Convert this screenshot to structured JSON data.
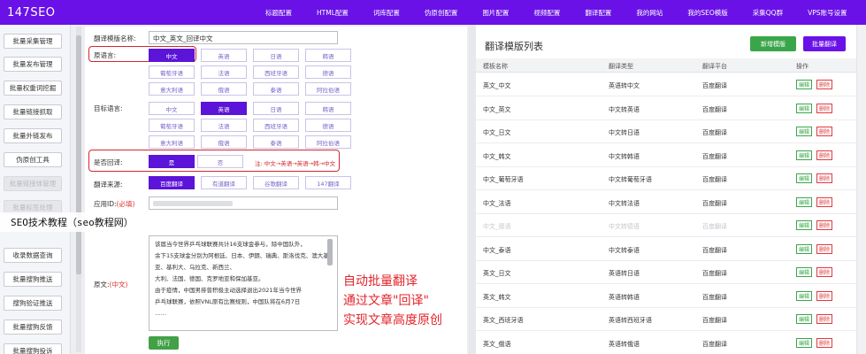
{
  "app": {
    "logo": "147SEO"
  },
  "top_nav": [
    "标题配置",
    "HTML配置",
    "词库配置",
    "伪原创配置",
    "图片配置",
    "视频配置",
    "翻译配置",
    "我的网站",
    "我的SEO模版",
    "采集QQ群",
    "VPS账号设置"
  ],
  "sidebar": {
    "items": [
      "批量采集管理",
      "批量发布管理",
      "批量权重词挖掘",
      "批量链接抓取",
      "批量外链发布",
      "伪原创工具",
      "批量链接体管理",
      "批量标签处理",
      "",
      "收录数据查询",
      "批量搜狗推送",
      "搜狗验证推送",
      "批量搜狗反馈",
      "批量搜狗投诉"
    ],
    "dim_items": [
      6,
      7
    ]
  },
  "form": {
    "template_name_label": "翻译模版名称:",
    "template_name_value": "中文_英文_回译中文",
    "source_lang_label": "原语言:",
    "source_langs": [
      "中文",
      "英语",
      "日语",
      "韩语",
      "葡萄牙语",
      "法语",
      "西班牙语",
      "德语",
      "意大利语",
      "俄语",
      "泰语",
      "阿拉伯语"
    ],
    "source_selected": "中文",
    "target_lang_label": "目标语言:",
    "target_langs": [
      "中文",
      "英语",
      "日语",
      "韩语",
      "葡萄牙语",
      "法语",
      "西班牙语",
      "德语",
      "意大利语",
      "俄语",
      "泰语",
      "阿拉伯语"
    ],
    "target_selected": "英语",
    "back_translate_label": "是否回译:",
    "back_yes": "是",
    "back_no": "否",
    "back_note": "注: 中文→英语→英语→韩→中文",
    "source_label": "翻译来源:",
    "sources": [
      "百度翻译",
      "有道翻译",
      "谷歌翻译",
      "147翻译"
    ],
    "source_selected_engine": "百度翻译",
    "appid_label": "应用ID:",
    "appid_required": "(必填)",
    "original_label": "原文:",
    "original_lang": "(中文)",
    "original_text": [
      "该届当今世界乒乓球联赛共计16支球金参与，除中国队外，",
      "余下15支球金分别为阿根廷、日本、伊朗、瑞典、斯洛伐克、澳大基亚、基利大、乌拉克、新西兰、",
      "大利、法国、德国、克罗地亚和保加基亚。",
      "由于疫情，中国男排曾积极主动选择退出2021年当今世界",
      "乒乓球联赛，依照VNL原有比赛规则，中国队将在6月7日",
      "……"
    ],
    "run_button": "执行"
  },
  "captions": [
    "自动批量翻译",
    "通过文章\"回译\"",
    "实现文章高度原创"
  ],
  "overlay_text": "SEO技术教程（seo教程网）",
  "panel": {
    "title": "翻译模版列表",
    "add_button": "新增模版",
    "batch_button": "批量翻译",
    "columns": [
      "模板名称",
      "翻译类型",
      "翻译平台",
      "操作"
    ],
    "rows": [
      {
        "name": "英文_中文",
        "type": "英语转中文",
        "platform": "百度翻译",
        "dim": false
      },
      {
        "name": "中文_英文",
        "type": "中文转英语",
        "platform": "百度翻译",
        "dim": false
      },
      {
        "name": "中文_日文",
        "type": "中文转日语",
        "platform": "百度翻译",
        "dim": false
      },
      {
        "name": "中文_韩文",
        "type": "中文转韩语",
        "platform": "百度翻译",
        "dim": false
      },
      {
        "name": "中文_葡萄牙语",
        "type": "中文转葡萄牙语",
        "platform": "百度翻译",
        "dim": false
      },
      {
        "name": "中文_法语",
        "type": "中文转法语",
        "platform": "百度翻译",
        "dim": false
      },
      {
        "name": "中文_德语",
        "type": "中文转德语",
        "platform": "百度翻译",
        "dim": true
      },
      {
        "name": "中文_泰语",
        "type": "中文转泰语",
        "platform": "百度翻译",
        "dim": false
      },
      {
        "name": "英文_日文",
        "type": "英语转日语",
        "platform": "百度翻译",
        "dim": false
      },
      {
        "name": "英文_韩文",
        "type": "英语转韩语",
        "platform": "百度翻译",
        "dim": false
      },
      {
        "name": "英文_西班牙语",
        "type": "英语转西班牙语",
        "platform": "百度翻译",
        "dim": false
      },
      {
        "name": "英文_俄语",
        "type": "英语转俄语",
        "platform": "百度翻译",
        "dim": false
      }
    ],
    "edit_label": "编辑",
    "delete_label": "删除"
  }
}
